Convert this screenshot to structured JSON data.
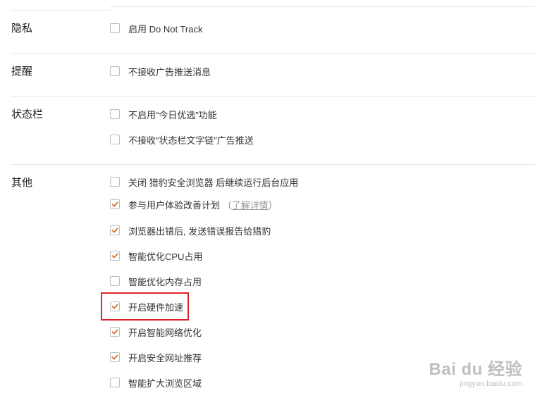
{
  "sections": {
    "privacy": {
      "title": "隐私",
      "options": [
        {
          "label": "启用 Do Not Track",
          "checked": false
        }
      ]
    },
    "reminder": {
      "title": "提醒",
      "options": [
        {
          "label": "不接收广告推送消息",
          "checked": false
        }
      ]
    },
    "statusbar": {
      "title": "状态栏",
      "options": [
        {
          "label": "不启用“今日优选”功能",
          "checked": false
        },
        {
          "label": "不接收“状态栏文字链”广告推送",
          "checked": false
        }
      ]
    },
    "other": {
      "title": "其他",
      "options": [
        {
          "label": "关闭 猎豹安全浏览器 后继续运行后台应用",
          "checked": false
        },
        {
          "label": "参与用户体验改善计划",
          "checked": true,
          "paren_open": "（",
          "link": "了解详情",
          "paren_close": "）"
        },
        {
          "label": "浏览器出错后, 发送错误报告给猎豹",
          "checked": true
        },
        {
          "label": "智能优化CPU占用",
          "checked": true
        },
        {
          "label": "智能优化内存占用",
          "checked": false
        },
        {
          "label": "开启硬件加速",
          "checked": true
        },
        {
          "label": "开启智能网络优化",
          "checked": true
        },
        {
          "label": "开启安全网址推荐",
          "checked": true
        },
        {
          "label": "智能扩大浏览区域",
          "checked": false
        }
      ]
    }
  },
  "watermark": {
    "brand": "Bai du 经验",
    "url": "jingyan.baidu.com"
  },
  "colors": {
    "checkmark": "#e06b2a",
    "highlight": "#e0202a",
    "divider": "#e6e6e6"
  }
}
